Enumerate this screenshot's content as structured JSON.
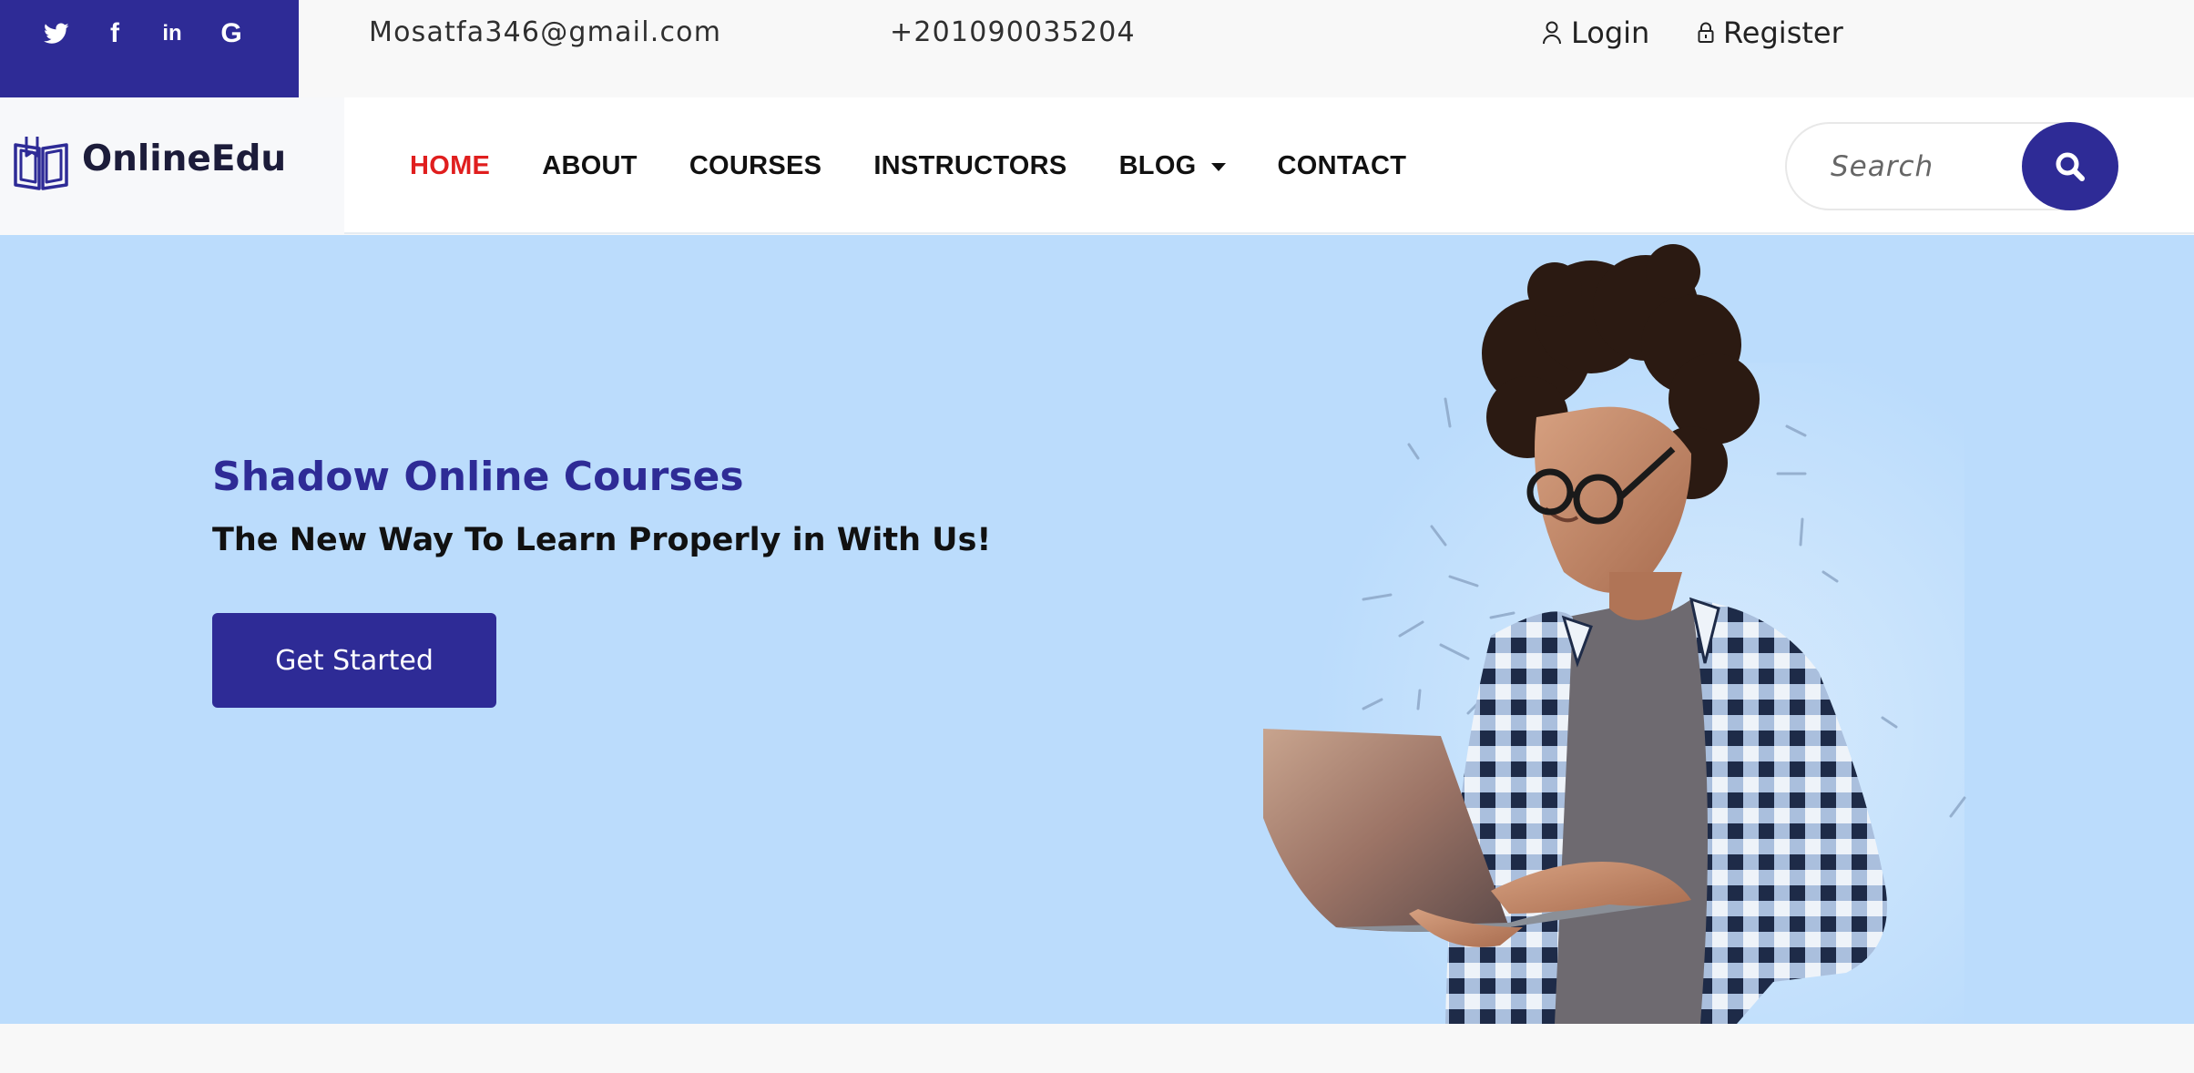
{
  "topbar": {
    "social": [
      "twitter-icon",
      "facebook-icon",
      "linkedin-icon",
      "google-icon"
    ],
    "social_glyphs": {
      "facebook": "f",
      "linkedin": "in",
      "google": "G"
    },
    "email": "Mosatfa346@gmail.com",
    "phone": "+201090035204",
    "login": "Login",
    "register": "Register"
  },
  "nav": {
    "brand": "OnlineEdu",
    "items": [
      {
        "label": "HOME",
        "active": true
      },
      {
        "label": "ABOUT"
      },
      {
        "label": "COURSES"
      },
      {
        "label": "INSTRUCTORS"
      },
      {
        "label": "BLOG",
        "dropdown": true
      },
      {
        "label": "CONTACT"
      }
    ],
    "search_placeholder": "Search"
  },
  "hero": {
    "title": "Shadow Online Courses",
    "subtitle": "The New Way To Learn Properly in With Us!",
    "cta": "Get Started"
  },
  "colors": {
    "primary": "#2e2b96",
    "active_nav": "#e01e1e",
    "hero_bg": "#bbdcfc"
  }
}
